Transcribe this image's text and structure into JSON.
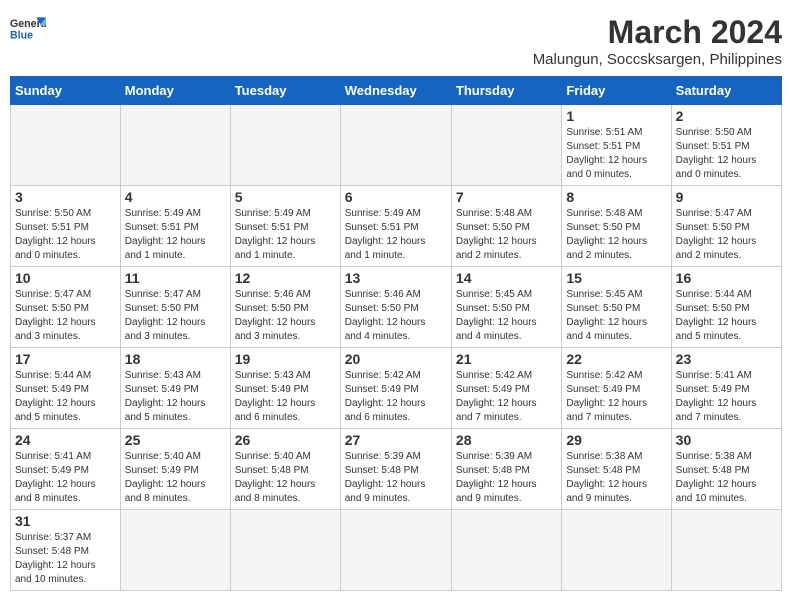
{
  "logo": {
    "line1": "General",
    "line2": "Blue"
  },
  "title": "March 2024",
  "location": "Malungun, Soccsksargen, Philippines",
  "days_of_week": [
    "Sunday",
    "Monday",
    "Tuesday",
    "Wednesday",
    "Thursday",
    "Friday",
    "Saturday"
  ],
  "weeks": [
    [
      {
        "day": "",
        "info": ""
      },
      {
        "day": "",
        "info": ""
      },
      {
        "day": "",
        "info": ""
      },
      {
        "day": "",
        "info": ""
      },
      {
        "day": "",
        "info": ""
      },
      {
        "day": "1",
        "info": "Sunrise: 5:51 AM\nSunset: 5:51 PM\nDaylight: 12 hours\nand 0 minutes."
      },
      {
        "day": "2",
        "info": "Sunrise: 5:50 AM\nSunset: 5:51 PM\nDaylight: 12 hours\nand 0 minutes."
      }
    ],
    [
      {
        "day": "3",
        "info": "Sunrise: 5:50 AM\nSunset: 5:51 PM\nDaylight: 12 hours\nand 0 minutes."
      },
      {
        "day": "4",
        "info": "Sunrise: 5:49 AM\nSunset: 5:51 PM\nDaylight: 12 hours\nand 1 minute."
      },
      {
        "day": "5",
        "info": "Sunrise: 5:49 AM\nSunset: 5:51 PM\nDaylight: 12 hours\nand 1 minute."
      },
      {
        "day": "6",
        "info": "Sunrise: 5:49 AM\nSunset: 5:51 PM\nDaylight: 12 hours\nand 1 minute."
      },
      {
        "day": "7",
        "info": "Sunrise: 5:48 AM\nSunset: 5:50 PM\nDaylight: 12 hours\nand 2 minutes."
      },
      {
        "day": "8",
        "info": "Sunrise: 5:48 AM\nSunset: 5:50 PM\nDaylight: 12 hours\nand 2 minutes."
      },
      {
        "day": "9",
        "info": "Sunrise: 5:47 AM\nSunset: 5:50 PM\nDaylight: 12 hours\nand 2 minutes."
      }
    ],
    [
      {
        "day": "10",
        "info": "Sunrise: 5:47 AM\nSunset: 5:50 PM\nDaylight: 12 hours\nand 3 minutes."
      },
      {
        "day": "11",
        "info": "Sunrise: 5:47 AM\nSunset: 5:50 PM\nDaylight: 12 hours\nand 3 minutes."
      },
      {
        "day": "12",
        "info": "Sunrise: 5:46 AM\nSunset: 5:50 PM\nDaylight: 12 hours\nand 3 minutes."
      },
      {
        "day": "13",
        "info": "Sunrise: 5:46 AM\nSunset: 5:50 PM\nDaylight: 12 hours\nand 4 minutes."
      },
      {
        "day": "14",
        "info": "Sunrise: 5:45 AM\nSunset: 5:50 PM\nDaylight: 12 hours\nand 4 minutes."
      },
      {
        "day": "15",
        "info": "Sunrise: 5:45 AM\nSunset: 5:50 PM\nDaylight: 12 hours\nand 4 minutes."
      },
      {
        "day": "16",
        "info": "Sunrise: 5:44 AM\nSunset: 5:50 PM\nDaylight: 12 hours\nand 5 minutes."
      }
    ],
    [
      {
        "day": "17",
        "info": "Sunrise: 5:44 AM\nSunset: 5:49 PM\nDaylight: 12 hours\nand 5 minutes."
      },
      {
        "day": "18",
        "info": "Sunrise: 5:43 AM\nSunset: 5:49 PM\nDaylight: 12 hours\nand 5 minutes."
      },
      {
        "day": "19",
        "info": "Sunrise: 5:43 AM\nSunset: 5:49 PM\nDaylight: 12 hours\nand 6 minutes."
      },
      {
        "day": "20",
        "info": "Sunrise: 5:42 AM\nSunset: 5:49 PM\nDaylight: 12 hours\nand 6 minutes."
      },
      {
        "day": "21",
        "info": "Sunrise: 5:42 AM\nSunset: 5:49 PM\nDaylight: 12 hours\nand 7 minutes."
      },
      {
        "day": "22",
        "info": "Sunrise: 5:42 AM\nSunset: 5:49 PM\nDaylight: 12 hours\nand 7 minutes."
      },
      {
        "day": "23",
        "info": "Sunrise: 5:41 AM\nSunset: 5:49 PM\nDaylight: 12 hours\nand 7 minutes."
      }
    ],
    [
      {
        "day": "24",
        "info": "Sunrise: 5:41 AM\nSunset: 5:49 PM\nDaylight: 12 hours\nand 8 minutes."
      },
      {
        "day": "25",
        "info": "Sunrise: 5:40 AM\nSunset: 5:49 PM\nDaylight: 12 hours\nand 8 minutes."
      },
      {
        "day": "26",
        "info": "Sunrise: 5:40 AM\nSunset: 5:48 PM\nDaylight: 12 hours\nand 8 minutes."
      },
      {
        "day": "27",
        "info": "Sunrise: 5:39 AM\nSunset: 5:48 PM\nDaylight: 12 hours\nand 9 minutes."
      },
      {
        "day": "28",
        "info": "Sunrise: 5:39 AM\nSunset: 5:48 PM\nDaylight: 12 hours\nand 9 minutes."
      },
      {
        "day": "29",
        "info": "Sunrise: 5:38 AM\nSunset: 5:48 PM\nDaylight: 12 hours\nand 9 minutes."
      },
      {
        "day": "30",
        "info": "Sunrise: 5:38 AM\nSunset: 5:48 PM\nDaylight: 12 hours\nand 10 minutes."
      }
    ],
    [
      {
        "day": "31",
        "info": "Sunrise: 5:37 AM\nSunset: 5:48 PM\nDaylight: 12 hours\nand 10 minutes."
      },
      {
        "day": "",
        "info": ""
      },
      {
        "day": "",
        "info": ""
      },
      {
        "day": "",
        "info": ""
      },
      {
        "day": "",
        "info": ""
      },
      {
        "day": "",
        "info": ""
      },
      {
        "day": "",
        "info": ""
      }
    ]
  ]
}
